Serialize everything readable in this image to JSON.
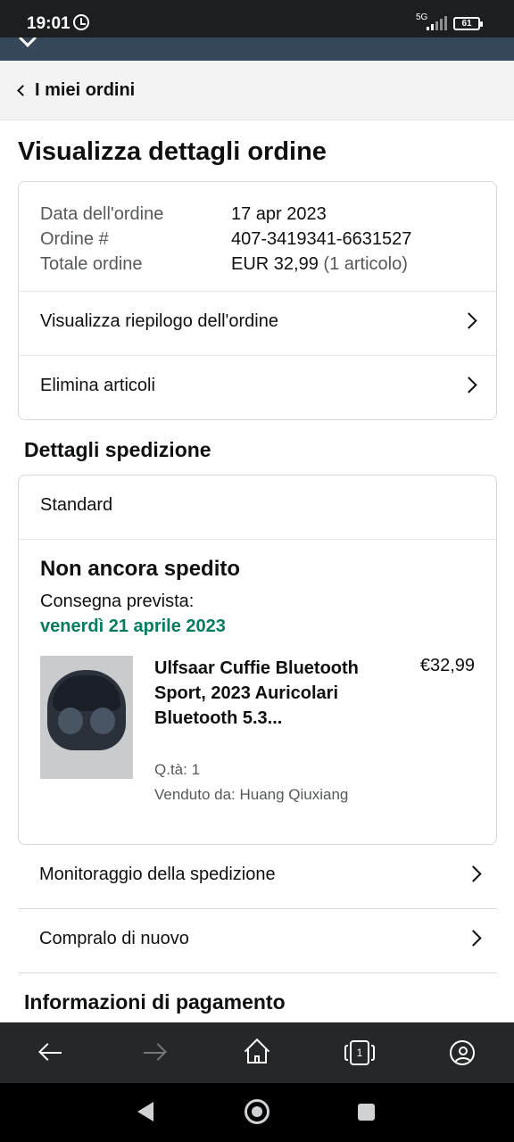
{
  "status_bar": {
    "time": "19:01",
    "network": "5G",
    "battery": "61"
  },
  "header": {
    "back_label": "I miei ordini"
  },
  "page": {
    "title": "Visualizza dettagli ordine"
  },
  "order_summary": {
    "date_label": "Data dell'ordine",
    "date_value": "17 apr 2023",
    "order_label": "Ordine #",
    "order_value": "407-3419341-6631527",
    "total_label": "Totale ordine",
    "total_value": "EUR 32,99",
    "total_items": "(1 articolo)"
  },
  "order_links": {
    "view_summary": "Visualizza riepilogo dell'ordine",
    "delete_items": "Elimina articoli"
  },
  "shipping": {
    "section_title": "Dettagli spedizione",
    "method": "Standard",
    "status": "Non ancora spedito",
    "eta_label": "Consegna prevista:",
    "eta_date": "venerdì 21 aprile 2023",
    "item": {
      "title": "Ulfsaar Cuffie Bluetooth Sport, 2023 Auricolari Bluetooth 5.3...",
      "price": "€32,99",
      "qty": "Q.tà: 1",
      "seller": "Venduto da: Huang Qiuxiang"
    },
    "track_label": "Monitoraggio della spedizione",
    "buy_again_label": "Compralo di nuovo"
  },
  "payment": {
    "section_title": "Informazioni di pagamento"
  },
  "browser_bar": {
    "tab_count": "1"
  },
  "colors": {
    "accent_green": "#067d62",
    "header_strip": "#37475a"
  }
}
